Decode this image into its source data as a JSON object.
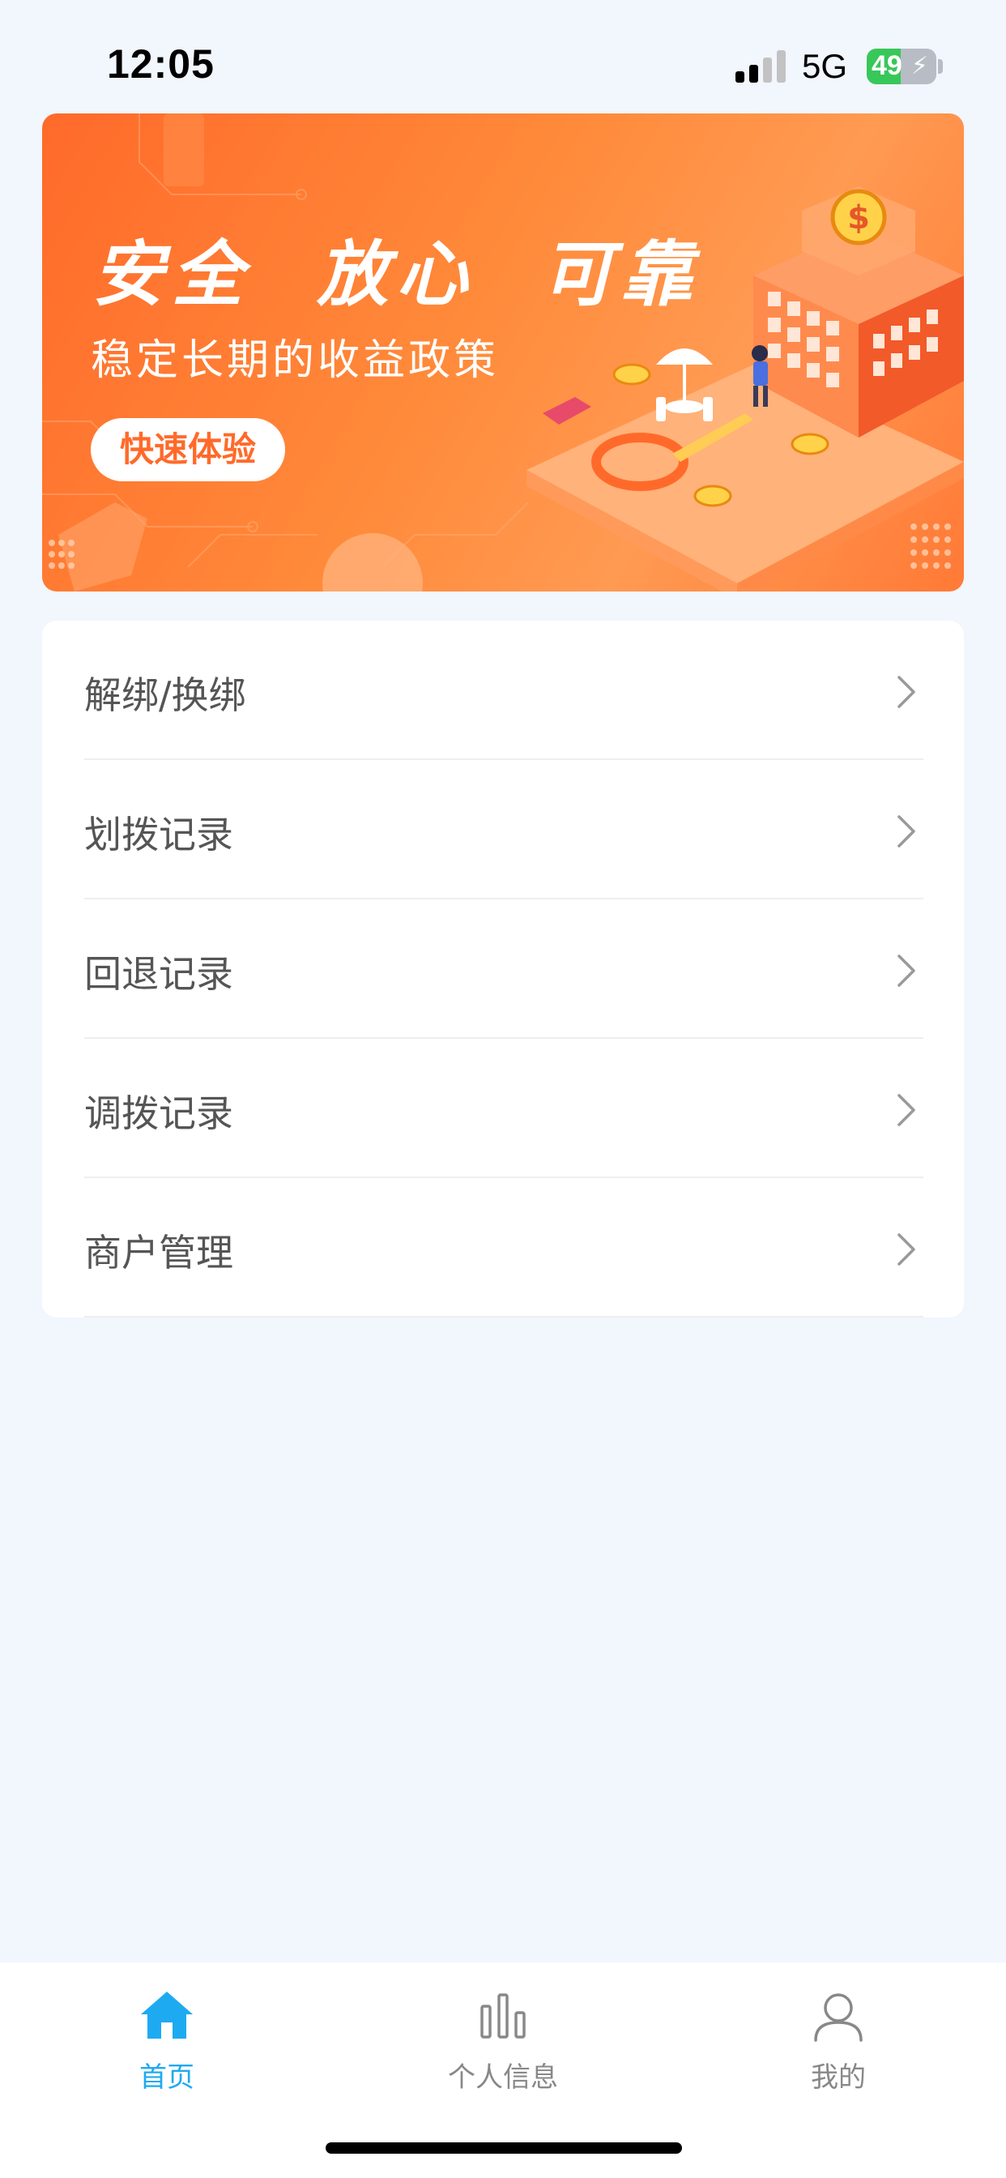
{
  "status_bar": {
    "time": "12:05",
    "network": "5G",
    "battery": "49",
    "battery_level": 0.49
  },
  "banner": {
    "title": "安全  放心  可靠",
    "subtitle": "稳定长期的收益政策",
    "button": "快速体验",
    "colors": {
      "start": "#ff6a2a",
      "end": "#ff9a52"
    }
  },
  "menu": {
    "items": [
      {
        "label": "解绑/换绑"
      },
      {
        "label": "划拨记录"
      },
      {
        "label": "回退记录"
      },
      {
        "label": "调拨记录"
      },
      {
        "label": "商户管理"
      }
    ]
  },
  "tab_bar": {
    "accent": "#1eaaf1",
    "tabs": [
      {
        "label": "首页",
        "icon": "home-icon",
        "active": true
      },
      {
        "label": "个人信息",
        "icon": "bar-chart-icon",
        "active": false
      },
      {
        "label": "我的",
        "icon": "user-icon",
        "active": false
      }
    ]
  }
}
